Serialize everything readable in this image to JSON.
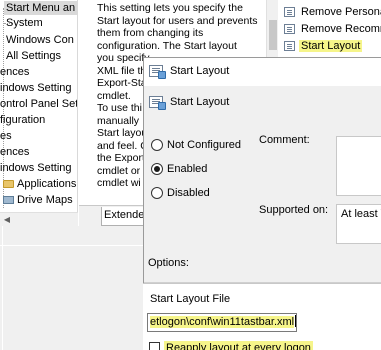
{
  "tree": {
    "items": [
      {
        "label": "Start Menu an",
        "selected": true
      },
      {
        "label": "System"
      },
      {
        "label": "Windows Con"
      },
      {
        "label": "All Settings"
      },
      {
        "label": "ences"
      },
      {
        "label": "indows Setting"
      },
      {
        "label": "ontrol Panel Set"
      },
      {
        "label": "figuration"
      },
      {
        "label": "es"
      },
      {
        "label": "ences"
      },
      {
        "label": "indows Setting"
      },
      {
        "label": "Applications"
      },
      {
        "label": "Drive Maps"
      }
    ]
  },
  "description": {
    "lines": [
      "This setting lets you specify the",
      "Start layout for users and prevents",
      "them from changing its",
      "configuration. The Start layout",
      "you specify",
      "XML file th",
      "Export-Sta",
      "cmdlet.",
      "To use thi",
      "manually",
      "Start layou",
      "and feel. C",
      "the Export",
      "cmdlet or",
      "cmdlet wi"
    ],
    "tab_label": "Extended"
  },
  "policy_list": {
    "items": [
      {
        "label": "Remove Personali"
      },
      {
        "label": "Remove Recomm"
      },
      {
        "label": "Start Layout",
        "highlighted": true
      }
    ]
  },
  "dialog": {
    "title": "Start Layout",
    "heading": "Start Layout",
    "radio_options": [
      {
        "label": "Not Configured",
        "checked": false
      },
      {
        "label": "Enabled",
        "checked": true
      },
      {
        "label": "Disabled",
        "checked": false
      }
    ],
    "comment_label": "Comment:",
    "supported_label": "Supported on:",
    "supported_value": "At least W",
    "options_label": "Options:",
    "file_label": "Start Layout File",
    "file_value": "etlogon\\conf\\win11tastbar.xml",
    "reapply_label": "Reapply layout at every logon",
    "reapply_checked": false
  },
  "colors": {
    "highlight": "#f6f58a",
    "window_bg": "#f0f0f0",
    "selection": "#d9d9d9"
  }
}
